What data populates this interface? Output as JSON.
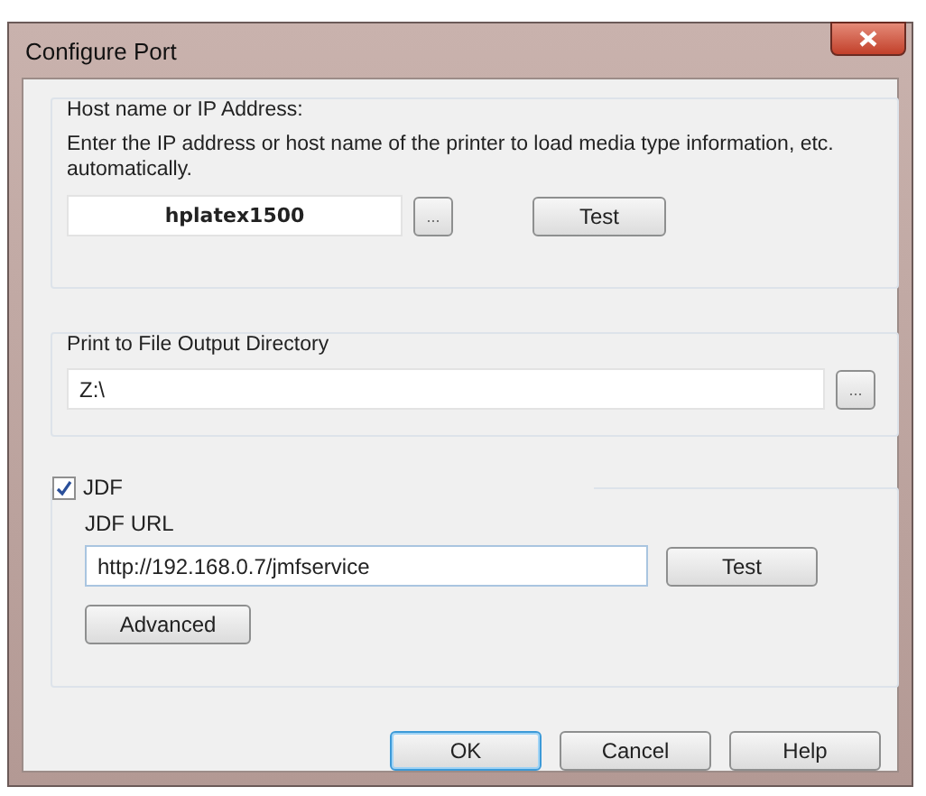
{
  "window": {
    "title": "Configure Port"
  },
  "host_group": {
    "label": "Host name or IP Address:",
    "description": "Enter the IP address or host name of the printer to load media type information, etc. automatically.",
    "host_field": {
      "value": "hplatex1500"
    },
    "browse_button": "...",
    "test_button": "Test"
  },
  "output_group": {
    "label": "Print to File Output Directory",
    "path_field": {
      "value": "Z:\\"
    },
    "browse_button": "..."
  },
  "jdf_group": {
    "checkbox": {
      "label": "JDF",
      "checked": true
    },
    "url_label": "JDF URL",
    "url_field": {
      "value": "http://192.168.0.7/jmfservice"
    },
    "test_button": "Test",
    "advanced_button": "Advanced"
  },
  "buttons": [
    {
      "label": "OK",
      "default": true
    },
    {
      "label": "Cancel",
      "default": false
    },
    {
      "label": "Help",
      "default": false
    }
  ]
}
